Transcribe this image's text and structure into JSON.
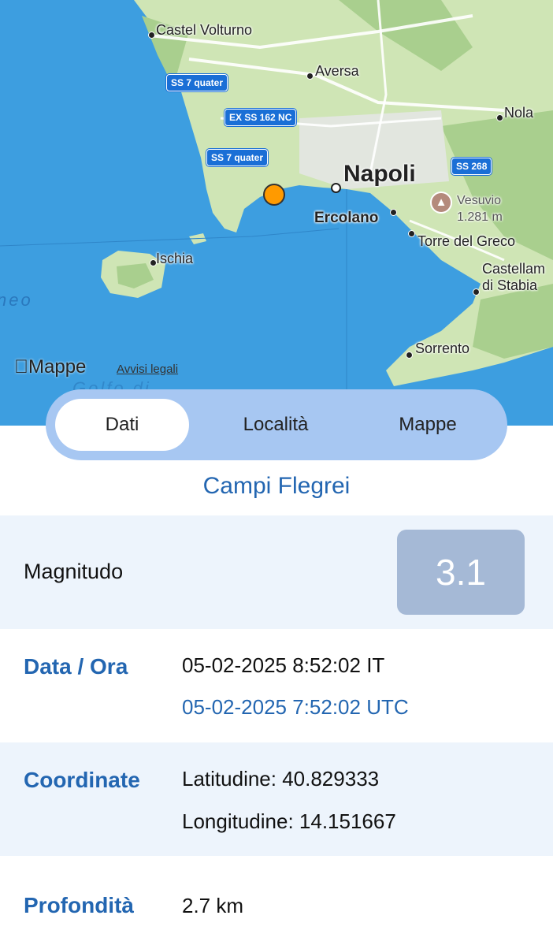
{
  "map": {
    "places": {
      "castel_volturno": "Castel Volturno",
      "aversa": "Aversa",
      "nola": "Nola",
      "napoli": "Napoli",
      "ercolano": "Ercolano",
      "torre_del_greco": "Torre del Greco",
      "castellammare_1": "Castellam",
      "castellammare_2": "di Stabia",
      "sorrento": "Sorrento",
      "ischia": "Ischia",
      "vesuvio": "Vesuvio",
      "vesuvio_height": "1.281 m",
      "sea_partial": "neo",
      "gulf_partial": "Golfo di"
    },
    "road_shields": {
      "ss7_quater_a": "SS 7 quater",
      "ex_ss162": "EX SS 162 NC",
      "ss7_quater_b": "SS 7 quater",
      "ss268": "SS 268"
    },
    "attribution": "Mappe",
    "legal_link": "Avvisi legali",
    "colors": {
      "sea": "#3d9ee0",
      "land": "#cfe5b5",
      "forest": "#a9cf8e",
      "quake_marker": "#ff9a00"
    }
  },
  "segments": [
    {
      "label": "Dati",
      "selected": true
    },
    {
      "label": "Località",
      "selected": false
    },
    {
      "label": "Mappe",
      "selected": false
    }
  ],
  "event": {
    "area": "Campi Flegrei",
    "magnitude_label": "Magnitudo",
    "magnitude_value": "3.1",
    "datetime_label": "Data / Ora",
    "datetime_local": "05-02-2025 8:52:02 IT",
    "datetime_utc": "05-02-2025 7:52:02 UTC",
    "coords_label": "Coordinate",
    "latitude": "Latitudine: 40.829333",
    "longitude": "Longitudine: 14.151667",
    "depth_label": "Profondità",
    "depth_value": "2.7 km"
  }
}
